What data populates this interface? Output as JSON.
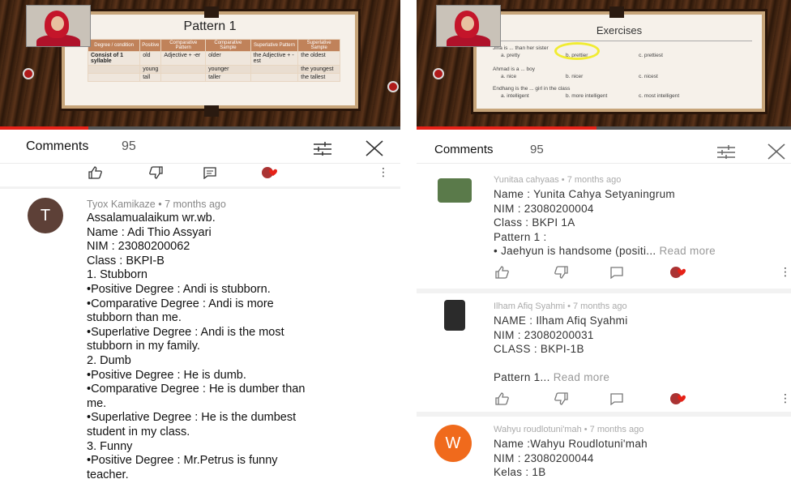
{
  "left": {
    "slide": {
      "title": "Pattern 1",
      "headers": [
        "Degree / condition",
        "Positive",
        "Comparative Pattern",
        "Comparative Sample",
        "Superlative Pattern",
        "Superlative Sample"
      ],
      "rows": [
        [
          "Consist of 1 syllable",
          "old",
          "Adjective + -er",
          "older",
          "the Adjective + -est",
          "the oldest"
        ],
        [
          "",
          "young",
          "",
          "younger",
          "",
          "the youngest"
        ],
        [
          "",
          "tall",
          "",
          "taller",
          "",
          "the tallest"
        ]
      ]
    },
    "comments_header": {
      "title": "Comments",
      "count": "95"
    },
    "more_glyph": "⋮",
    "comment": {
      "avatar_letter": "T",
      "avatar_color": "#5d4037",
      "meta": "Tyox Kamikaze • 7 months ago",
      "lines": [
        "Assalamualaikum wr.wb.",
        "Name : Adi Thio Assyari",
        "NIM : 23080200062",
        "Class : BKPI-B",
        "1. Stubborn",
        " •Positive Degree : Andi is stubborn.",
        " •Comparative Degree : Andi is more",
        "stubborn than me.",
        " •Superlative Degree : Andi is the most",
        "stubborn in my family.",
        "2. Dumb",
        " •Positive Degree : He is dumb.",
        " •Comparative Degree : He is dumber than",
        "me.",
        "•Superlative Degree : He is the dumbest",
        "student in my class.",
        "3. Funny",
        " •Positive Degree : Mr.Petrus is funny",
        "teacher."
      ]
    }
  },
  "right": {
    "slide": {
      "title": "Exercises",
      "q1": "Jina is ... than her sister",
      "q1_opts": [
        "a. pretty",
        "b. prettier",
        "c. prettiest"
      ],
      "q2": "Ahmad is a ... boy",
      "q2_opts": [
        "a. nice",
        "b. nicer",
        "c. nicest"
      ],
      "q3": "Endhang is the ... girl in the class",
      "q3_opts": [
        "a. intelligent",
        "b. more intelligent",
        "c. most intelligent"
      ]
    },
    "comments_header": {
      "title": "Comments",
      "count": "95"
    },
    "more_glyph": "⋮",
    "comments": [
      {
        "meta": "Yunitaa cahyaas • 7 months ago",
        "avatar_color": "#5a7a4a",
        "lines": [
          "Name : Yunita Cahya Setyaningrum",
          "NIM : 23080200004",
          "Class : BKPI 1A",
          "Pattern 1 :"
        ],
        "last_line": "• Jaehyun is handsome (positi...",
        "read_more": "Read more"
      },
      {
        "meta": "Ilham Afiq Syahmi • 7 months ago",
        "avatar_color": "#2b2b2b",
        "lines": [
          "NAME : Ilham Afiq Syahmi",
          "NIM : 23080200031",
          "CLASS : BKPI-1B"
        ],
        "last_line": "Pattern 1...",
        "read_more": "Read more"
      },
      {
        "meta": "Wahyu roudlotuni'mah • 7 months ago",
        "avatar_letter": "W",
        "avatar_color": "#f06a1c",
        "lines": [
          "Name :Wahyu Roudlotuni'mah",
          "NIM : 23080200044",
          "Kelas : 1B"
        ]
      }
    ]
  }
}
